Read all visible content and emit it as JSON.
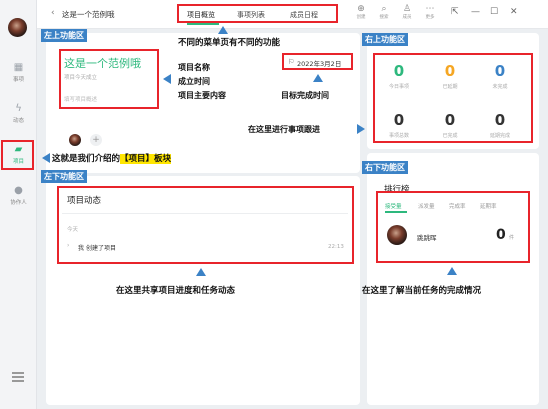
{
  "window": {
    "title": "这是一个范例哦",
    "back_icon": "chevron-left-icon"
  },
  "tabs": [
    {
      "label": "项目概览",
      "active": true
    },
    {
      "label": "事项列表",
      "active": false
    },
    {
      "label": "成员日程",
      "active": false
    }
  ],
  "toolbar": [
    {
      "label": "创建",
      "icon": "plus-circle-icon"
    },
    {
      "label": "搜索",
      "icon": "search-icon"
    },
    {
      "label": "成员",
      "icon": "members-icon"
    },
    {
      "label": "更多",
      "icon": "more-icon"
    }
  ],
  "sidebar": {
    "items": [
      {
        "label": "事项",
        "icon": "calendar-icon"
      },
      {
        "label": "动态",
        "icon": "pulse-icon"
      },
      {
        "label": "项目",
        "icon": "folder-icon",
        "active": true
      },
      {
        "label": "协作人",
        "icon": "person-icon"
      }
    ]
  },
  "project": {
    "name": "这是一个范例哦",
    "founded": "项目今天成立",
    "description_placeholder": "填写项目概述",
    "target_date": "2022年3月2日"
  },
  "stats": [
    {
      "value": "0",
      "label": "今日事项",
      "color": "#2db87d"
    },
    {
      "value": "0",
      "label": "已延期",
      "color": "#f5a623"
    },
    {
      "value": "0",
      "label": "未完成",
      "color": "#3b82c6"
    },
    {
      "value": "0",
      "label": "事项总数",
      "color": "#333333"
    },
    {
      "value": "0",
      "label": "已完成",
      "color": "#333333"
    },
    {
      "value": "0",
      "label": "延期完成",
      "color": "#333333"
    }
  ],
  "activity": {
    "title": "项目动态",
    "day": "今天",
    "entry_user": "我",
    "entry_text": "创建了项目",
    "entry_time": "22:13"
  },
  "ranking": {
    "title": "排行榜",
    "tabs": [
      "接受量",
      "派发量",
      "完成率",
      "延期率"
    ],
    "user": "跳跳晖",
    "count": "0",
    "unit": "件"
  },
  "annotations": {
    "label_top_left": "左上功能区",
    "label_top_right": "右上功能区",
    "label_bottom_left": "左下功能区",
    "label_bottom_right": "右下功能区",
    "tabs_note": "不同的菜单页有不同的功能",
    "info_note_1": "项目名称",
    "info_note_2": "成立时间",
    "info_note_3": "项目主要内容",
    "date_note": "目标完成时间",
    "tracking_note": "在这里进行事项跟进",
    "module_note_prefix": "这就是我们介绍的",
    "module_note_highlight": "【项目】板块",
    "activity_note": "在这里共享项目进度和任务动态",
    "ranking_note": "在这里了解当前任务的完成情况"
  },
  "colors": {
    "accent": "#2db87d",
    "annotation_blue": "#3b82c6",
    "annotation_red": "#e8242b",
    "highlight": "#ffe600"
  }
}
